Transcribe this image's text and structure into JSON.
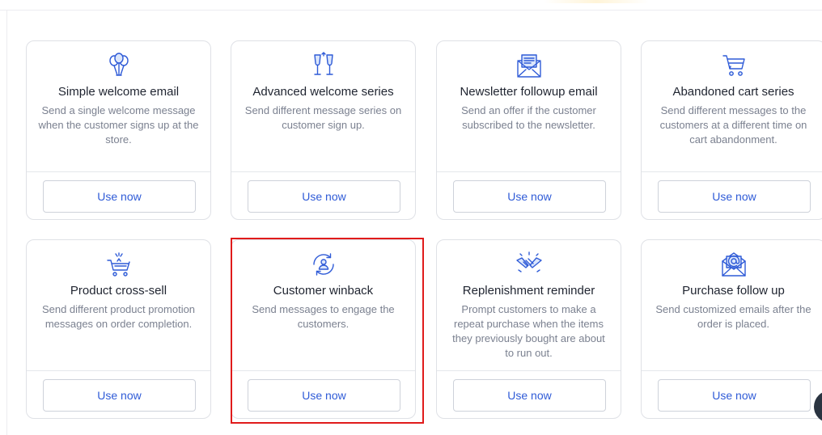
{
  "colors": {
    "accent": "#2f5bd7",
    "highlight": "#e01b1b",
    "icon": "#2f5bd7"
  },
  "cards": [
    {
      "title": "Simple welcome email",
      "description": "Send a single welcome message when the customer signs up at the store.",
      "button": "Use now",
      "icon": "balloons-icon"
    },
    {
      "title": "Advanced welcome series",
      "description": "Send different message series on customer sign up.",
      "button": "Use now",
      "icon": "champagne-glasses-icon"
    },
    {
      "title": "Newsletter followup email",
      "description": "Send an offer if the customer subscribed to the newsletter.",
      "button": "Use now",
      "icon": "newsletter-envelope-icon"
    },
    {
      "title": "Abandoned cart series",
      "description": "Send different messages to the customers at a different time on cart abandonment.",
      "button": "Use now",
      "icon": "shopping-cart-icon"
    },
    {
      "title": "Product cross-sell",
      "description": "Send different product promotion messages on order completion.",
      "button": "Use now",
      "icon": "basket-icon"
    },
    {
      "title": "Customer winback",
      "description": "Send messages to engage the customers.",
      "button": "Use now",
      "icon": "user-refresh-icon"
    },
    {
      "title": "Replenishment reminder",
      "description": "Prompt customers to make a repeat purchase when the items they previously bought are about to run out.",
      "button": "Use now",
      "icon": "handshake-icon"
    },
    {
      "title": "Purchase follow up",
      "description": "Send customized emails after the order is placed.",
      "button": "Use now",
      "icon": "email-at-icon"
    }
  ]
}
